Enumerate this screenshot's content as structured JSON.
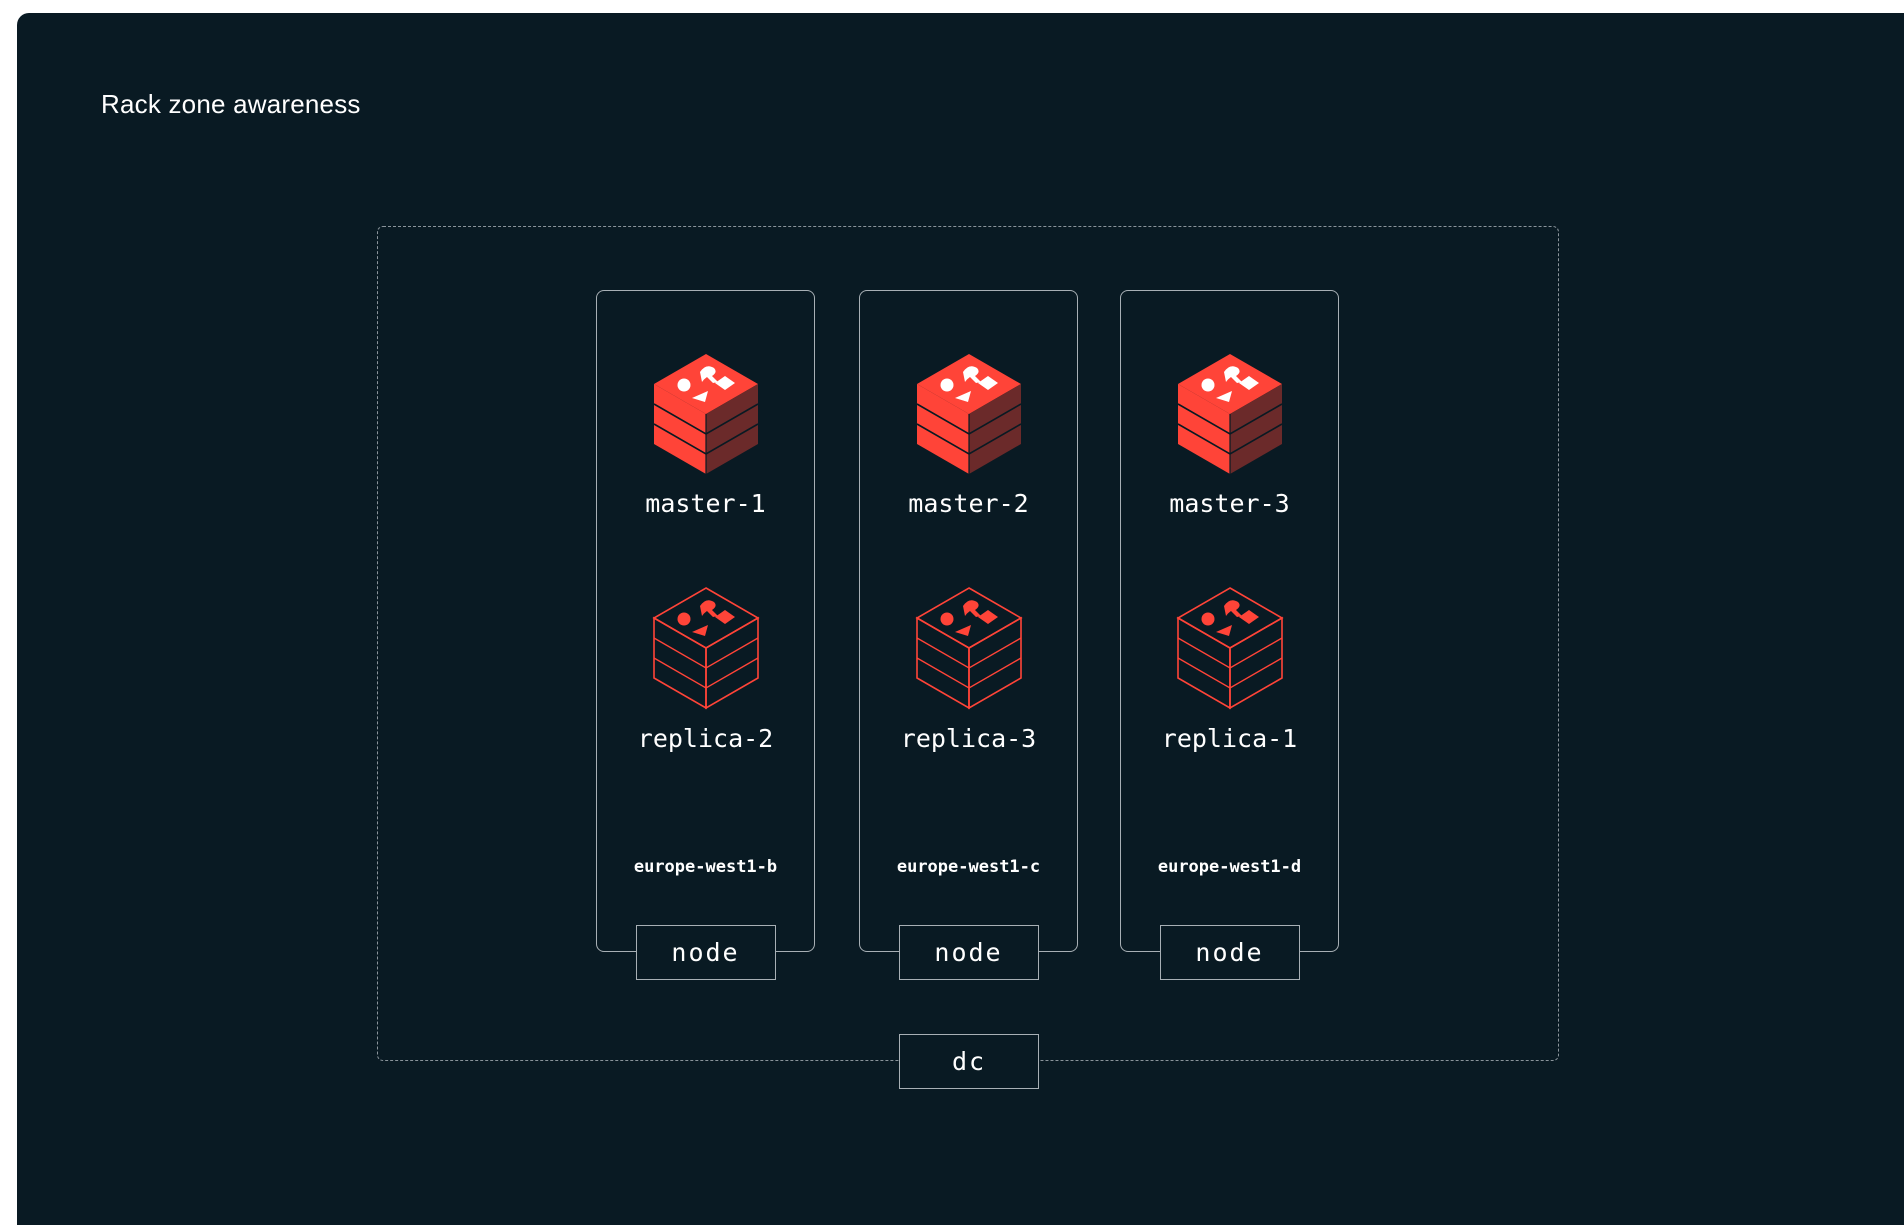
{
  "title": "Rack zone awareness",
  "dc_label": "dc",
  "colors": {
    "background": "#091a23",
    "accent": "#ff4438",
    "border": "#a8b0b5"
  },
  "icons": {
    "master": "redis-cube-filled-icon",
    "replica": "redis-cube-outline-icon"
  },
  "nodes": [
    {
      "master": "master-1",
      "replica": "replica-2",
      "zone": "europe-west1-b",
      "label": "node"
    },
    {
      "master": "master-2",
      "replica": "replica-3",
      "zone": "europe-west1-c",
      "label": "node"
    },
    {
      "master": "master-3",
      "replica": "replica-1",
      "zone": "europe-west1-d",
      "label": "node"
    }
  ]
}
